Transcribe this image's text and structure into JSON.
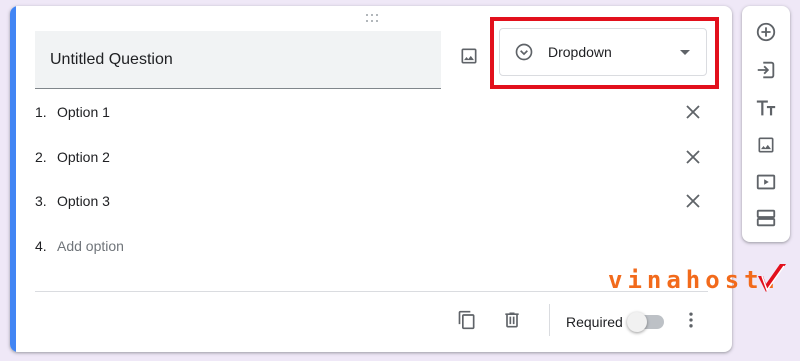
{
  "question": {
    "title": "Untitled Question",
    "type_label": "Dropdown",
    "options": [
      {
        "number": "1.",
        "label": "Option 1"
      },
      {
        "number": "2.",
        "label": "Option 2"
      },
      {
        "number": "3.",
        "label": "Option 3"
      }
    ],
    "add_option": {
      "number": "4.",
      "label": "Add option"
    }
  },
  "footer": {
    "required_label": "Required",
    "required_on": false
  },
  "side_toolbar": {
    "icons": [
      "add-question-icon",
      "import-questions-icon",
      "add-title-icon",
      "add-image-icon",
      "add-video-icon",
      "add-section-icon"
    ]
  },
  "watermark": {
    "text": "vinahost."
  },
  "colors": {
    "accent": "#4285f4",
    "highlight": "#e2101c",
    "background": "#efe8f7",
    "watermark": "#f26a1b"
  }
}
